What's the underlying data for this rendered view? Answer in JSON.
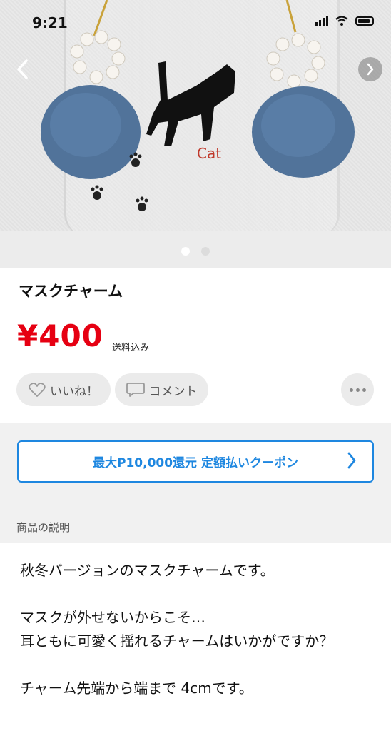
{
  "status_bar": {
    "time": "9:21"
  },
  "gallery": {
    "prev_icon": "chevron-left-icon",
    "next_icon": "chevron-right-icon",
    "pages": 2,
    "current_page": 1,
    "image_text": "Cat"
  },
  "product": {
    "title": "マスクチャーム",
    "price": "¥400",
    "shipping": "送料込み"
  },
  "actions": {
    "like_label": "いいね！",
    "comment_label": "コメント"
  },
  "coupon": {
    "label": "最大P10,000還元 定額払いクーポン"
  },
  "description": {
    "heading": "商品の説明",
    "lines": [
      "秋冬バージョンのマスクチャームです。",
      "マスクが外せないからこそ…",
      "耳ともに可愛く揺れるチャームはいかがですか？",
      "チャーム先端から端まで 4cmです。"
    ]
  },
  "colors": {
    "price": "#e60012",
    "accent": "#1e87e0"
  }
}
